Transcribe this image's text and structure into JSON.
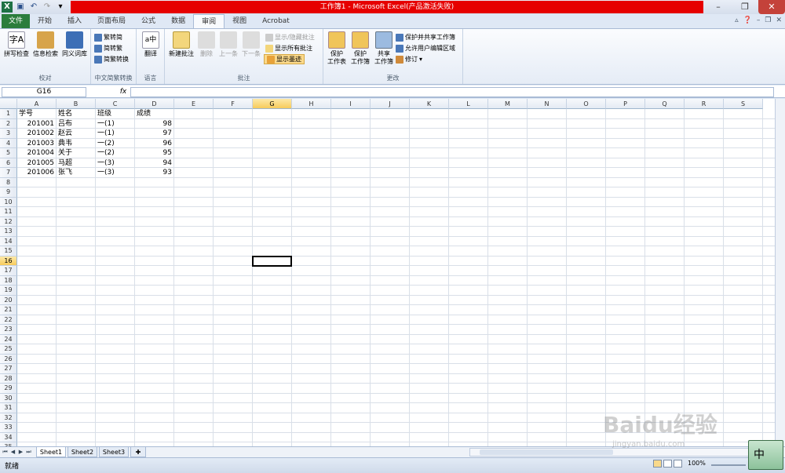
{
  "title": "工作簿1 - Microsoft Excel(产品激活失败)",
  "tabs": [
    "文件",
    "开始",
    "插入",
    "页面布局",
    "公式",
    "数据",
    "审阅",
    "视图",
    "Acrobat"
  ],
  "active_tab": "审阅",
  "ribbon": {
    "proofing": {
      "label": "校对",
      "spell": "拼写检查",
      "research": "信息检索",
      "thesaurus": "同义词库"
    },
    "chinese": {
      "label": "中文简繁转换",
      "to_simp": "繁转简",
      "to_trad": "简转繁",
      "convert": "简繁转换"
    },
    "language": {
      "label": "语言",
      "translate": "翻译"
    },
    "comments": {
      "label": "批注",
      "new": "新建批注",
      "delete": "删除",
      "prev": "上一条",
      "next": "下一条",
      "show_hide": "显示/隐藏批注",
      "show_all": "显示所有批注",
      "show_ink": "显示墨迹"
    },
    "changes": {
      "label": "更改",
      "protect_sheet": "保护\n工作表",
      "protect_wb": "保护\n工作簿",
      "share_wb": "共享\n工作簿",
      "protect_share": "保护并共享工作簿",
      "allow_edit": "允许用户编辑区域",
      "track": "修订"
    }
  },
  "namebox": "G16",
  "fx": "fx",
  "columns": [
    "A",
    "B",
    "C",
    "D",
    "E",
    "F",
    "G",
    "H",
    "I",
    "J",
    "K",
    "L",
    "M",
    "N",
    "O",
    "P",
    "Q",
    "R",
    "S"
  ],
  "selected_col": "G",
  "selected_row": "16",
  "rows": [
    "1",
    "2",
    "3",
    "4",
    "5",
    "6",
    "7",
    "8",
    "9",
    "10",
    "11",
    "12",
    "13",
    "14",
    "15",
    "16",
    "17",
    "18",
    "19",
    "20",
    "21",
    "22",
    "23",
    "24",
    "25",
    "26",
    "27",
    "28",
    "29",
    "30",
    "31",
    "32",
    "33",
    "34",
    "35"
  ],
  "table": {
    "headers": [
      "学号",
      "姓名",
      "班级",
      "成绩"
    ],
    "data": [
      [
        "201001",
        "吕布",
        "一(1)",
        "98"
      ],
      [
        "201002",
        "赵云",
        "一(1)",
        "97"
      ],
      [
        "201003",
        "典韦",
        "一(2)",
        "96"
      ],
      [
        "201004",
        "关于",
        "一(2)",
        "95"
      ],
      [
        "201005",
        "马超",
        "一(3)",
        "94"
      ],
      [
        "201006",
        "张飞",
        "一(3)",
        "93"
      ]
    ]
  },
  "sheets": [
    "Sheet1",
    "Sheet2",
    "Sheet3"
  ],
  "active_sheet": "Sheet1",
  "status": "就绪",
  "zoom": "100%",
  "ime": "中",
  "watermark": "Baidu经验",
  "watermark_url": "jingyan.baidu.com"
}
